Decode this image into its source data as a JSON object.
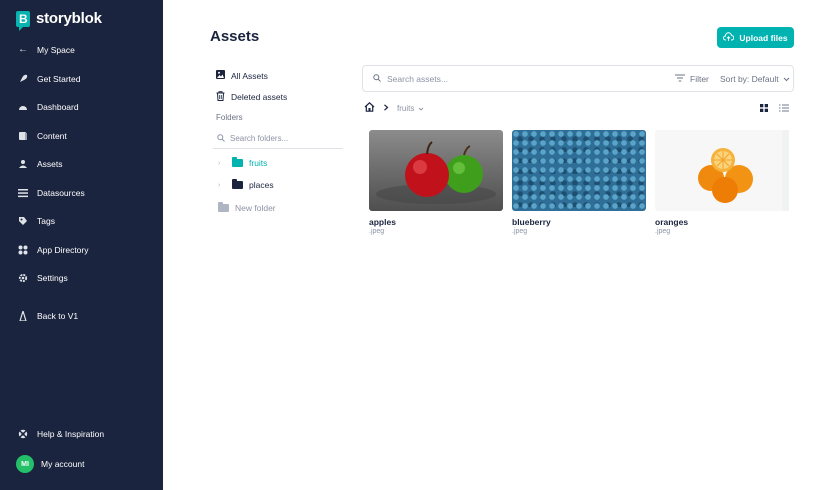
{
  "brand": {
    "name": "storyblok"
  },
  "nav": {
    "back": "My Space",
    "items": [
      {
        "label": "Get Started",
        "icon": "rocket-icon"
      },
      {
        "label": "Dashboard",
        "icon": "dashboard-icon"
      },
      {
        "label": "Content",
        "icon": "content-icon"
      },
      {
        "label": "Assets",
        "icon": "assets-icon"
      },
      {
        "label": "Datasources",
        "icon": "datasources-icon"
      },
      {
        "label": "Tags",
        "icon": "tag-icon"
      },
      {
        "label": "App Directory",
        "icon": "apps-icon"
      },
      {
        "label": "Settings",
        "icon": "gear-icon"
      }
    ],
    "back_v1": "Back to V1",
    "help": "Help & Inspiration",
    "account": "My account",
    "avatar_initials": "MI"
  },
  "page": {
    "title": "Assets",
    "upload_label": "Upload files"
  },
  "panel": {
    "all_assets": "All Assets",
    "deleted_assets": "Deleted assets",
    "folders_heading": "Folders",
    "folder_search_placeholder": "Search folders...",
    "folders": [
      {
        "name": "fruits",
        "active": true
      },
      {
        "name": "places",
        "active": false
      }
    ],
    "new_folder": "New folder"
  },
  "search": {
    "placeholder": "Search assets...",
    "filter_label": "Filter",
    "sort_label": "Sort by: Default"
  },
  "breadcrumb": {
    "current": "fruits"
  },
  "assets": [
    {
      "name": "apples",
      "ext": ".jpeg"
    },
    {
      "name": "blueberry",
      "ext": ".jpeg"
    },
    {
      "name": "oranges",
      "ext": ".jpeg"
    }
  ],
  "colors": {
    "sidebar": "#1b243f",
    "accent": "#00b3b0",
    "avatar": "#23c069"
  }
}
